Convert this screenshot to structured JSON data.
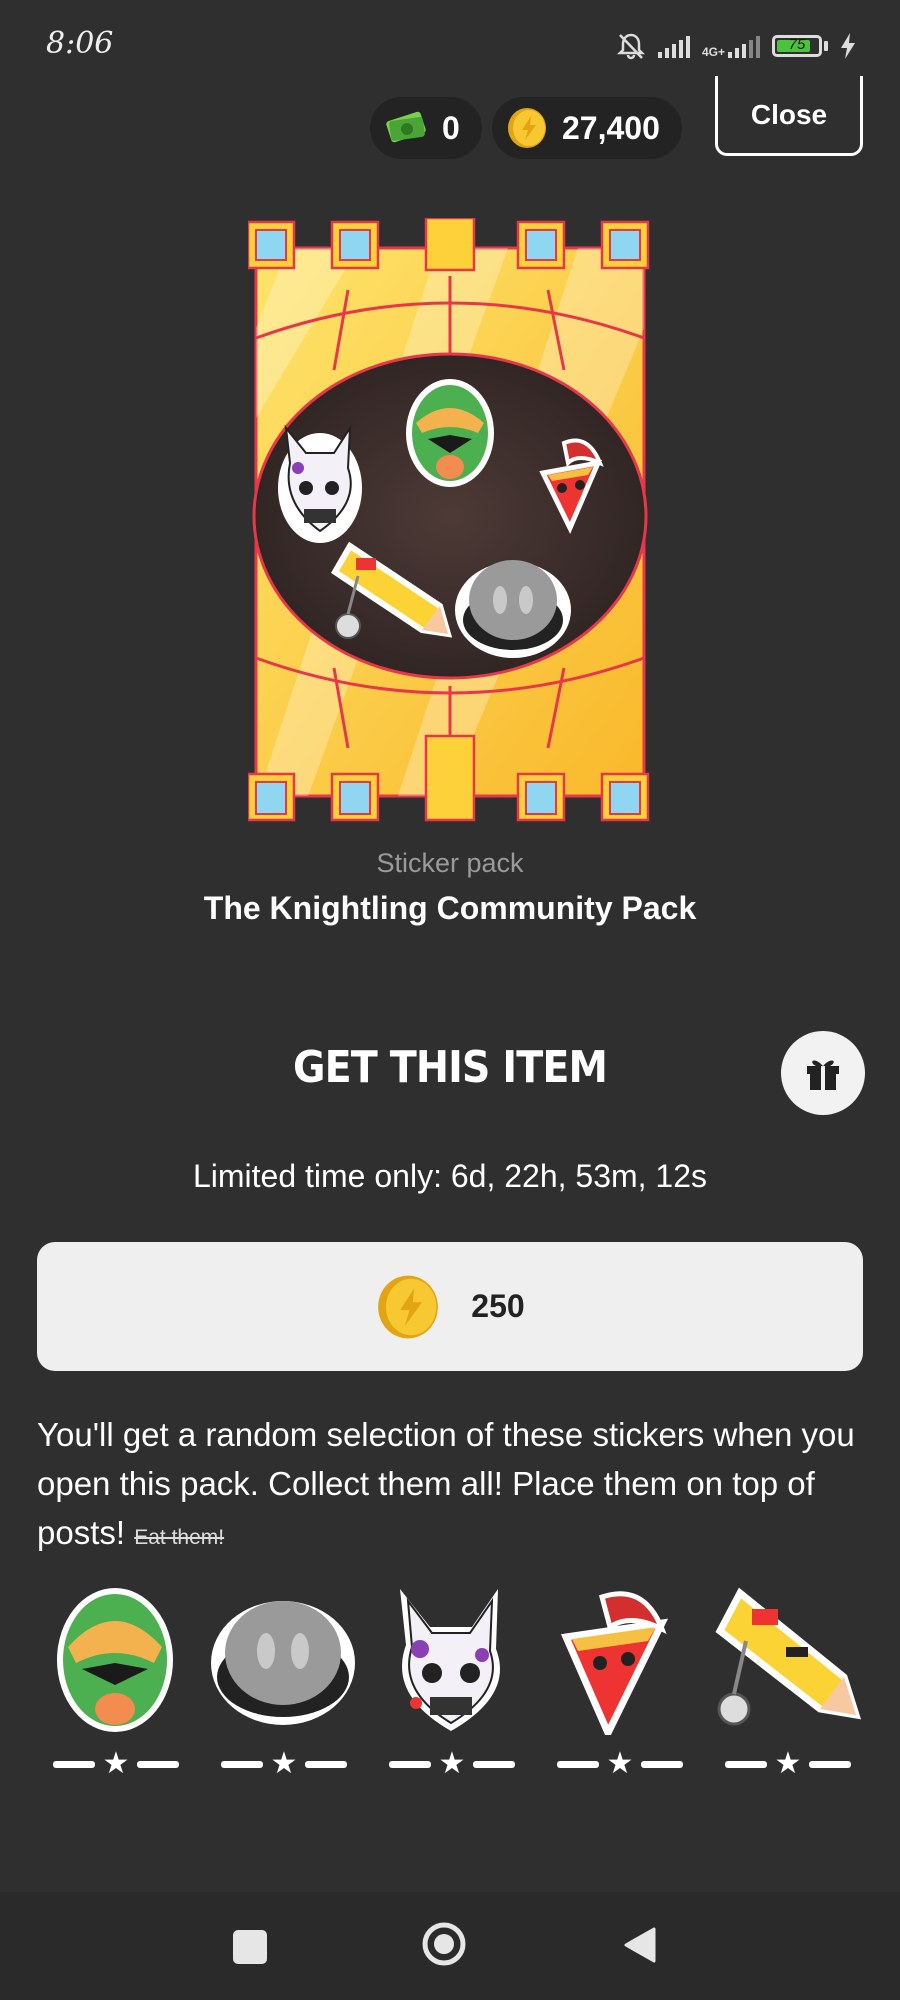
{
  "status_bar": {
    "time": "8:06",
    "network_label": "4G+",
    "battery_level": "75"
  },
  "header": {
    "cash_amount": "0",
    "coin_amount": "27,400",
    "close_label": "Close"
  },
  "pack": {
    "subtitle": "Sticker pack",
    "title": "The Knightling Community Pack"
  },
  "purchase": {
    "heading": "GET THIS ITEM",
    "timer_text": "Limited time only: 6d, 22h, 53m, 12s",
    "price": "250"
  },
  "description": {
    "text": "You'll get a random selection of these stickers when you open this pack. Collect them all! Place them on top of posts!",
    "strikethrough": "Eat them!"
  },
  "stickers": [
    {
      "name": "ranger-mask-sticker",
      "rarity_stars": 1
    },
    {
      "name": "ghost-sticker",
      "rarity_stars": 1
    },
    {
      "name": "bunny-knight-sticker",
      "rarity_stars": 1
    },
    {
      "name": "pizza-slice-sticker",
      "rarity_stars": 1
    },
    {
      "name": "pencil-sticker",
      "rarity_stars": 1
    }
  ],
  "colors": {
    "background": "#2f2f2f",
    "coin_gold": "#f2b51d",
    "pack_yellow": "#fdd73e",
    "battery_green": "#4cc33e"
  }
}
